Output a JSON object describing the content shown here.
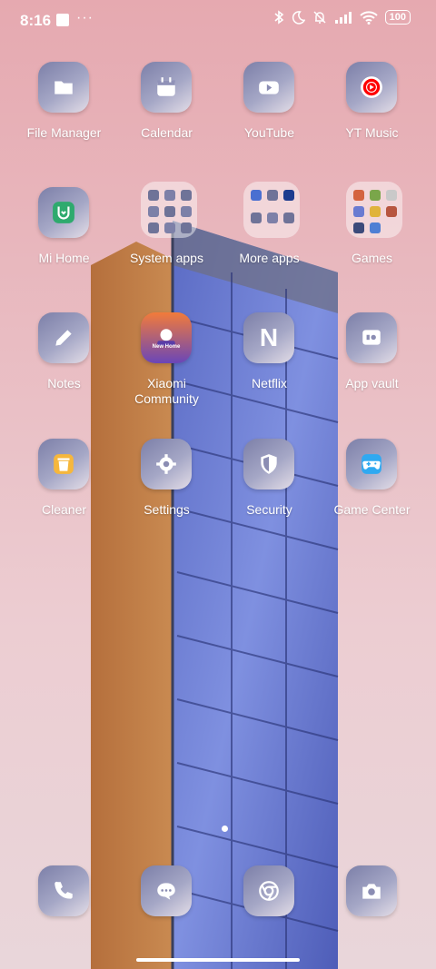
{
  "status_bar": {
    "time": "8:16",
    "dots": "···",
    "battery": "100"
  },
  "apps": [
    {
      "label": "File Manager",
      "icon": "folder-icon"
    },
    {
      "label": "Calendar",
      "icon": "calendar-icon"
    },
    {
      "label": "YouTube",
      "icon": "youtube-icon"
    },
    {
      "label": "YT Music",
      "icon": "yt-music-icon",
      "brand_color": "#ff0000"
    },
    {
      "label": "Mi Home",
      "icon": "mi-home-icon",
      "brand_color": "#2eaa6e"
    },
    {
      "label": "System apps",
      "icon": "folder"
    },
    {
      "label": "More apps",
      "icon": "folder"
    },
    {
      "label": "Games",
      "icon": "folder"
    },
    {
      "label": "Notes",
      "icon": "pencil-icon"
    },
    {
      "label": "Xiaomi Community",
      "icon": "xiaomi-community-icon",
      "icon_text": "New Home"
    },
    {
      "label": "Netflix",
      "icon": "netflix-icon",
      "icon_text": "N"
    },
    {
      "label": "App vault",
      "icon": "app-vault-icon"
    },
    {
      "label": "Cleaner",
      "icon": "trash-icon",
      "brand_color": "#f6b73c"
    },
    {
      "label": "Settings",
      "icon": "gear-icon"
    },
    {
      "label": "Security",
      "icon": "shield-icon"
    },
    {
      "label": "Game Center",
      "icon": "gamepad-icon",
      "brand_color": "#2fa9f1"
    }
  ],
  "dock": [
    {
      "icon": "phone-icon"
    },
    {
      "icon": "messages-icon"
    },
    {
      "icon": "chrome-icon"
    },
    {
      "icon": "camera-icon"
    }
  ]
}
